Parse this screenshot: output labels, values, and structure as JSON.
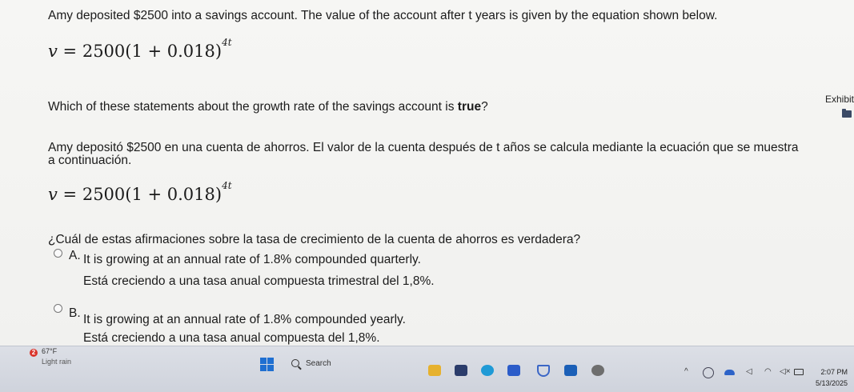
{
  "question": {
    "intro_en": "Amy deposited $2500 into a savings account. The value of the account after t years is given by the equation shown below.",
    "equation_lhs": "v",
    "equation_eq": " = ",
    "equation_body": "2500(1 + 0.018)",
    "equation_exp": "4t",
    "prompt_en": "Which of these statements about the growth rate of the savings account is",
    "prompt_en_bold": "true",
    "prompt_en_end": "?",
    "intro_es_line1": "Amy depositó $2500 en una cuenta de ahorros. El valor de la cuenta después de t años se calcula mediante la ecuación que se muestra",
    "intro_es_line2": "a continuación.",
    "prompt_es": "¿Cuál de estas afirmaciones sobre la tasa de crecimiento de la cuenta de ahorros es verdadera?"
  },
  "exhibit": {
    "label": "Exhibit",
    "icon": "folder-icon"
  },
  "options": [
    {
      "letter": "A.",
      "en": "It is growing at an annual rate of 1.8% compounded quarterly.",
      "es": "Está creciendo a una tasa anual compuesta trimestral del 1,8%."
    },
    {
      "letter": "B.",
      "en": "It is growing at an annual rate of 1.8% compounded yearly.",
      "es": "Está creciendo a una tasa anual compuesta del 1,8%."
    }
  ],
  "taskbar": {
    "weather_badge": "2",
    "weather_temp": "67°F",
    "weather_desc": "Light rain",
    "search_label": "Search",
    "time": "2:07 PM",
    "date": "5/13/2025"
  },
  "colors": {
    "accent": "#1f6fd1",
    "weather_badge": "#d9342b"
  }
}
